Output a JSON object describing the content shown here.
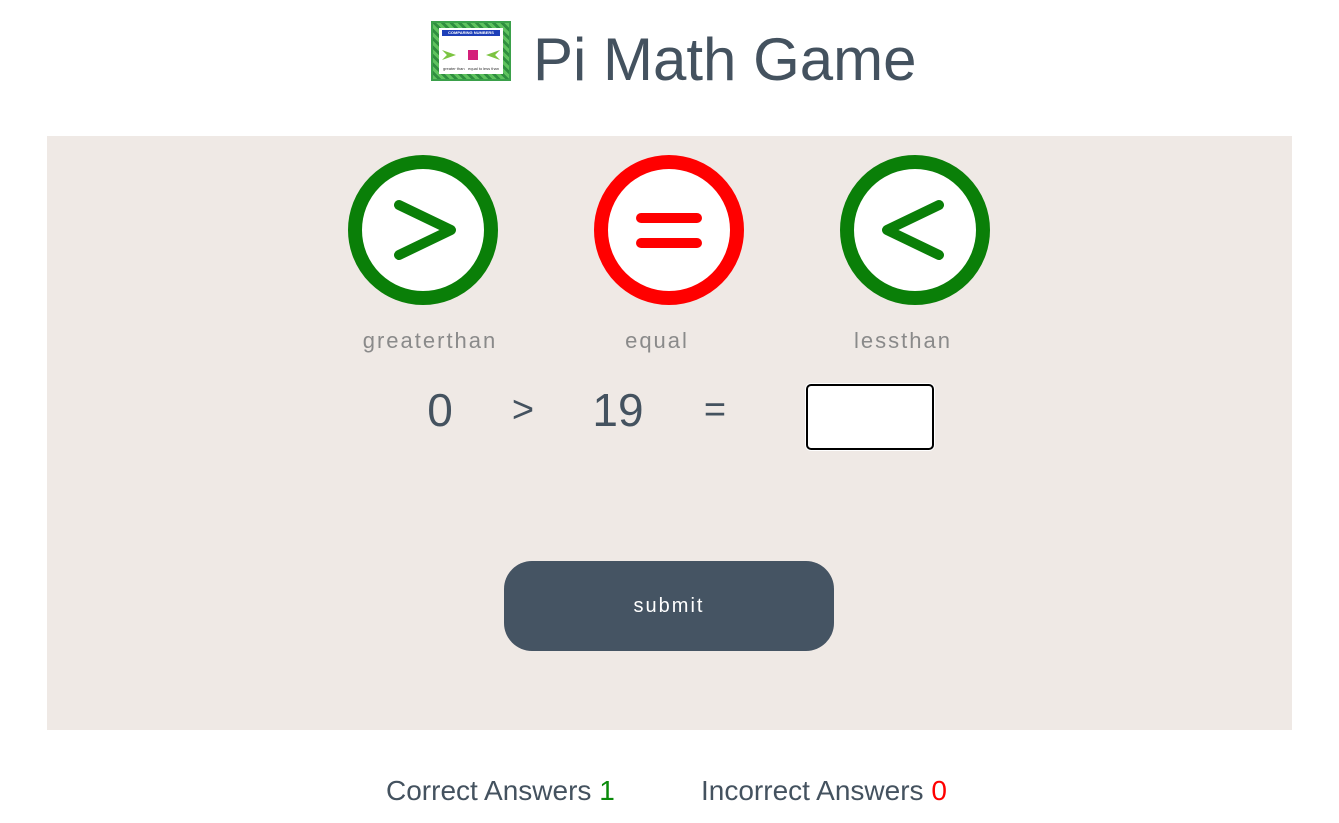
{
  "header": {
    "title": "Pi Math Game",
    "logo": {
      "icon": "comparing-numbers-logo-icon",
      "banner_text": "COMPARING NUMBERS",
      "captions": [
        "greater than",
        "equal to",
        "less than"
      ]
    }
  },
  "symbols": [
    {
      "label": "greaterthan",
      "icon": "greater-than-icon",
      "color": "#0a7f08"
    },
    {
      "label": "equal",
      "icon": "equal-sign-icon",
      "color": "#ff0000"
    },
    {
      "label": "lessthan",
      "icon": "less-than-icon",
      "color": "#0a7f08"
    }
  ],
  "equation": {
    "left_operand": "0",
    "operator": ">",
    "right_operand": "19",
    "equals": "=",
    "answer_value": ""
  },
  "submit": {
    "label": "submit",
    "color": "#455463"
  },
  "score": {
    "correct_label": "Correct Answers",
    "correct_value": "1",
    "correct_color": "#0a8a0a",
    "incorrect_label": "Incorrect Answers",
    "incorrect_value": "0",
    "incorrect_color": "#ff0000"
  },
  "colors": {
    "panel_background": "#efe9e5",
    "text": "#44525f"
  }
}
